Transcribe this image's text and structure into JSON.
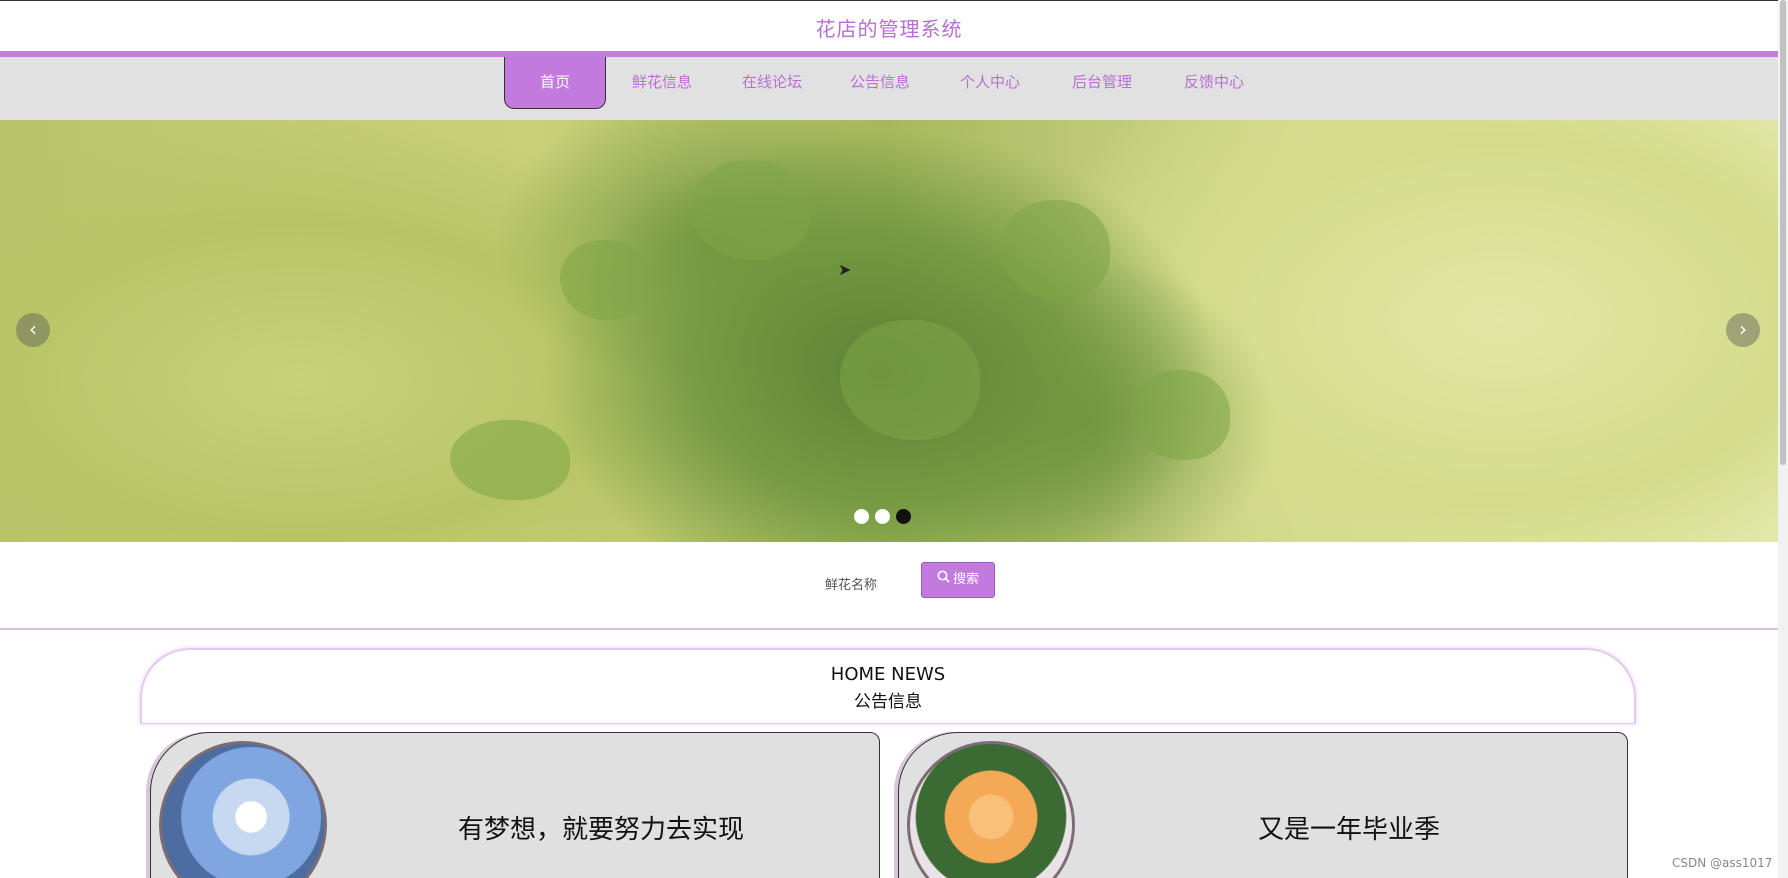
{
  "site": {
    "title": "花店的管理系统"
  },
  "nav": {
    "items": [
      {
        "label": "首页",
        "active": true
      },
      {
        "label": "鲜花信息"
      },
      {
        "label": "在线论坛"
      },
      {
        "label": "公告信息"
      },
      {
        "label": "个人中心"
      },
      {
        "label": "后台管理"
      },
      {
        "label": "反馈中心"
      }
    ]
  },
  "banner": {
    "slide_count": 3,
    "active_slide": 3,
    "prev_icon": "chevron-left-icon",
    "next_icon": "chevron-right-icon"
  },
  "search": {
    "label": "鲜花名称",
    "button_label": "搜索",
    "icon": "search-icon"
  },
  "news": {
    "title_en": "HOME NEWS",
    "title_cn": "公告信息",
    "items": [
      {
        "title": "有梦想，就要努力去实现"
      },
      {
        "title": "又是一年毕业季"
      }
    ]
  },
  "watermark": "CSDN @ass1017",
  "colors": {
    "accent": "#c37adf",
    "nav_bg": "#e2e1e2",
    "card_bg": "#e1e0e1"
  }
}
